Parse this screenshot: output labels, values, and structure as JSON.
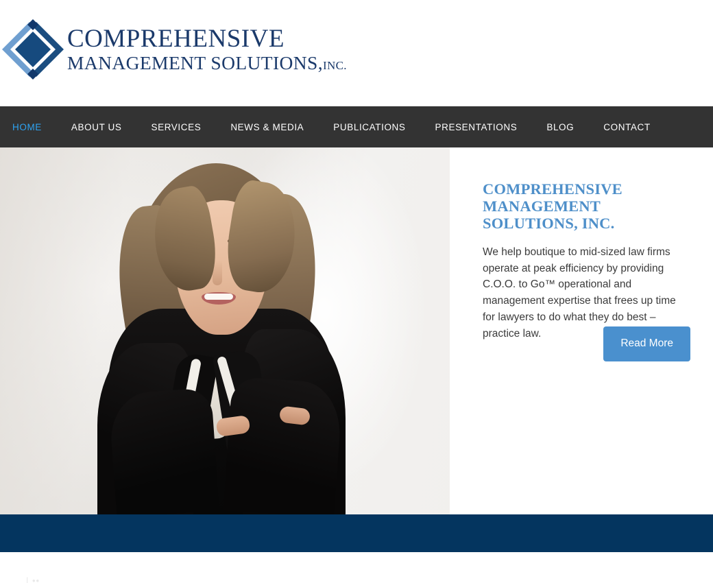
{
  "colors": {
    "logo_navy": "#1b3a6b",
    "logo_light_blue": "#6f9fd0",
    "logo_dark_blue": "#1b4d80",
    "nav_bg": "#333333",
    "nav_active": "#2ea3f2",
    "heading_blue": "#4e8fc9",
    "button_blue": "#4a90ce",
    "band_navy": "#04355f",
    "body_text": "#3b3b3b"
  },
  "header": {
    "logo": {
      "icon_name": "diamond-logo-mark",
      "line1": "COMPREHENSIVE",
      "line2": "MANAGEMENT SOLUTIONS,",
      "line2_suffix": "INC."
    }
  },
  "nav": {
    "items": [
      {
        "label": "HOME",
        "active": true
      },
      {
        "label": "ABOUT US",
        "active": false
      },
      {
        "label": "SERVICES",
        "active": false
      },
      {
        "label": "NEWS & MEDIA",
        "active": false
      },
      {
        "label": "PUBLICATIONS",
        "active": false
      },
      {
        "label": "PRESENTATIONS",
        "active": false
      },
      {
        "label": "BLOG",
        "active": false
      },
      {
        "label": "CONTACT",
        "active": false
      }
    ]
  },
  "hero": {
    "image_alt": "Professional portrait of a woman in a black blazer with arms crossed",
    "title": "COMPREHENSIVE MANAGEMENT SOLUTIONS, INC.",
    "body": "We help boutique to mid-sized law firms operate at peak efficiency by providing C.O.O. to Go™ operational and management expertise that frees up time for lawyers to do what they do best – practice law.",
    "cta_label": "Read More"
  },
  "bottom": {
    "ghost_text": "| ••"
  }
}
